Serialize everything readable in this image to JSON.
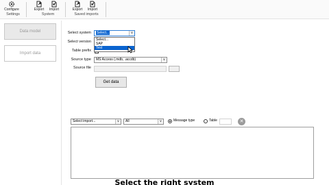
{
  "ribbon": {
    "buttons": [
      {
        "label": "Configure",
        "icon": "gear-icon"
      },
      {
        "label": "Export",
        "icon": "export-icon"
      },
      {
        "label": "Import",
        "icon": "import-icon"
      },
      {
        "label": "Export",
        "icon": "export-icon"
      },
      {
        "label": "Import",
        "icon": "import-icon"
      }
    ],
    "groups": [
      "Settings",
      "System",
      "Saved imports"
    ]
  },
  "sidebar": {
    "data_model": "Data model",
    "import_data": "Import data"
  },
  "form": {
    "select_system_label": "Select system",
    "select_system_value": "Select...",
    "select_version_label": "Select version",
    "table_prefix_label": "Table prefix",
    "source_type_label": "Source type",
    "source_type_value": "MS Access (.mdb, .accdb)",
    "source_file_label": "Source file",
    "get_data": "Get data"
  },
  "dropdown": {
    "options": [
      "Select...",
      "SAP",
      "Test"
    ],
    "highlighted": "Test"
  },
  "log_filter": {
    "import_select": "Select import...",
    "level_select": "All",
    "message_type": "Message type",
    "table": "Table",
    "selected_radio": "Message type"
  },
  "caption": "Select the right system"
}
